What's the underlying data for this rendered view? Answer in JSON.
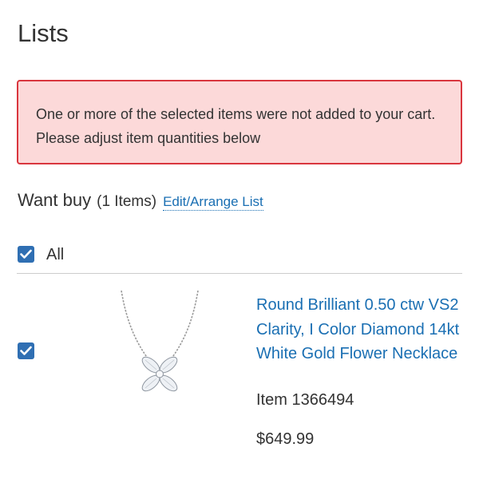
{
  "page": {
    "title": "Lists"
  },
  "alert": {
    "message": "One or more of the selected items were not added to your cart. Please adjust item quantities below"
  },
  "list": {
    "name": "Want buy",
    "count": "(1 Items)",
    "edit_link": "Edit/Arrange List",
    "select_all_label": "All",
    "select_all_checked": true,
    "items": [
      {
        "checked": true,
        "title": "Round Brilliant 0.50 ctw VS2 Clarity, I Color Diamond 14kt White Gold Flower Necklace",
        "item_number": "Item 1366494",
        "price": "$649.99"
      }
    ]
  },
  "colors": {
    "accent": "#2f6fb3",
    "link": "#1a6fb3",
    "alert_bg": "#fcd9d9",
    "alert_border": "#d9363e"
  }
}
